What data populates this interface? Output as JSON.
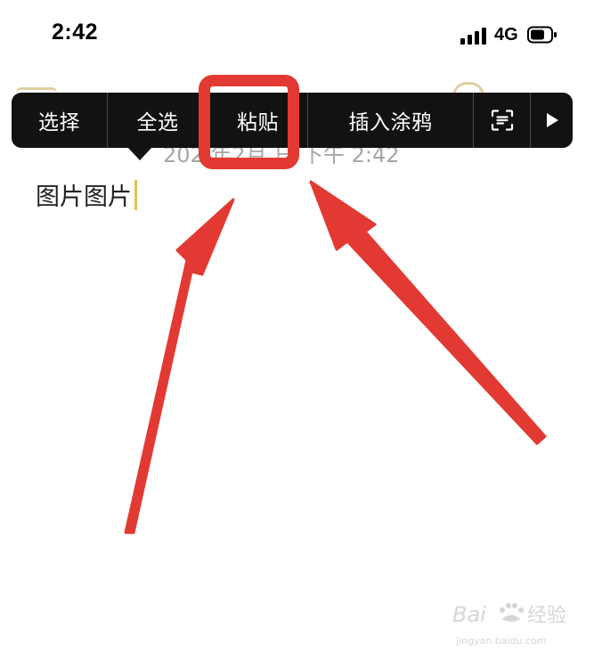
{
  "status_bar": {
    "time": "2:42",
    "network": "4G",
    "icons": [
      "cellular-signal-icon",
      "battery-icon"
    ]
  },
  "context_menu": {
    "items": [
      {
        "label": "选择"
      },
      {
        "label": "全选"
      },
      {
        "label": "粘贴"
      },
      {
        "label": "插入涂鸦"
      },
      {
        "label": "",
        "icon": "live-text-scan-icon"
      },
      {
        "label": "",
        "icon": "play-right-arrow-icon"
      }
    ]
  },
  "note": {
    "date_visible": "202  年2月  日 下午 2:42",
    "body": "图片图片"
  },
  "annotations": {
    "highlight_color": "#e23a33",
    "highlighted_item": "粘贴"
  },
  "colors": {
    "menu_bg": "#121212",
    "cursor": "#e4c04f",
    "date_text": "#a6a6a6"
  }
}
